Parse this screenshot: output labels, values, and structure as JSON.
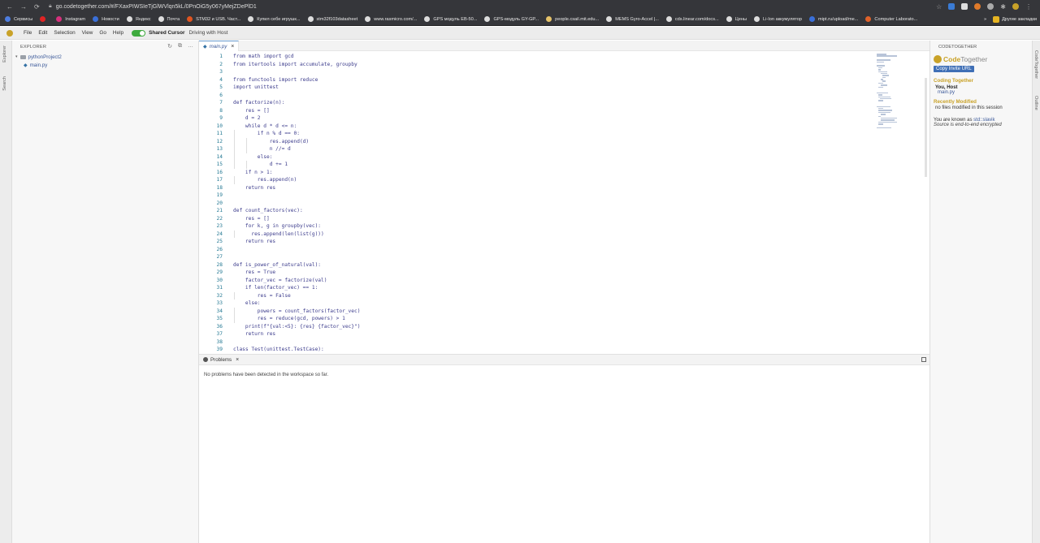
{
  "browser": {
    "url": "go.codetogether.com/#/FXaxPIWSIeTjGlWVlqn5kL/0PnOiG5y067yMejZDePlD1",
    "bookmarks": [
      {
        "label": "Сервисы",
        "color": "#4d7de0"
      },
      {
        "label": "",
        "color": "#e02424"
      },
      {
        "label": "Instagram",
        "color": "#d6307c"
      },
      {
        "label": "Новости",
        "color": "#3a6fd8"
      },
      {
        "label": "Яндекс",
        "color": "#dddddd"
      },
      {
        "label": "Почта",
        "color": "#dddddd"
      },
      {
        "label": "STM32 и USB. Част...",
        "color": "#e05520"
      },
      {
        "label": "Купил себе игрушк...",
        "color": "#dddddd"
      },
      {
        "label": "stm32f103datasheet",
        "color": "#dddddd"
      },
      {
        "label": "www.rasmicro.com/...",
        "color": "#dddddd"
      },
      {
        "label": "GPS модуль EB-50...",
        "color": "#dddddd"
      },
      {
        "label": "GPS-модуль GY-GP...",
        "color": "#dddddd"
      },
      {
        "label": "people.csail.mit.edu...",
        "color": "#e6c36a"
      },
      {
        "label": "MEMS Gyro-Accel |...",
        "color": "#dddddd"
      },
      {
        "label": "cds.linear.com/docs...",
        "color": "#dddddd"
      },
      {
        "label": "Цены",
        "color": "#dddddd"
      },
      {
        "label": "Li-Ion аккумулятор",
        "color": "#dddddd"
      },
      {
        "label": "mipt.ru/upload/me...",
        "color": "#3a6fd8"
      },
      {
        "label": "Computer Laborato...",
        "color": "#e0622a"
      }
    ],
    "bookmarks_more": "»",
    "other_bookmarks": "Другие закладки"
  },
  "menubar": {
    "items": [
      "File",
      "Edit",
      "Selection",
      "View",
      "Go",
      "Help"
    ],
    "shared_cursor_label": "Shared Cursor",
    "driving_label": "Driving with Host"
  },
  "activity": {
    "explorer_label": "Explorer",
    "search_label": "Search"
  },
  "explorer": {
    "title": "EXPLORER",
    "folder": "pythonProject2",
    "file": "main.py"
  },
  "editor": {
    "tab_label": "main.py",
    "current_line": 13,
    "lines": [
      "from math import gcd",
      "from itertools import accumulate, groupby",
      "",
      "from functools import reduce",
      "import unittest",
      "",
      "def factorize(n):",
      "    res = []",
      "    d = 2",
      "    while d * d <= n:",
      "        if n % d == 0:",
      "            res.append(d)",
      "            n //= d",
      "        else:",
      "            d += 1",
      "    if n > 1:",
      "        res.append(n)",
      "    return res",
      "",
      "",
      "def count_factors(vec):",
      "    res = []",
      "    for k, g in groupby(vec):",
      "      res.append(len(list(g)))",
      "    return res",
      "",
      "",
      "def is_power_of_natural(val):",
      "    res = True",
      "    factor_vec = factorize(val)",
      "    if len(factor_vec) == 1:",
      "        res = False",
      "    else:",
      "        powers = count_factors(factor_vec)",
      "        res = reduce(gcd, powers) > 1",
      "    print(f\"{val:<5}: {res} {factor_vec}\")",
      "    return res",
      "",
      "class Test(unittest.TestCase):"
    ]
  },
  "problems": {
    "tab_label": "Problems",
    "message": "No problems have been detected in the workspace so far."
  },
  "codetogether": {
    "panel_title": "CODETOGETHER",
    "logo_code": "Code",
    "logo_rest": "Together",
    "invite_button": "Copy Invite URL",
    "coding_together_title": "Coding Together",
    "you_host": "You, Host",
    "host_file": "main.py",
    "recently_modified_title": "Recently Modified",
    "no_files": "no files modified in this session",
    "known_as_prefix": "You are known as",
    "username": "std::slavik",
    "encrypted": "Source is end-to-end encrypted"
  },
  "right_activity": {
    "codetogether_label": "CodeTogether",
    "outline_label": "Outline"
  }
}
